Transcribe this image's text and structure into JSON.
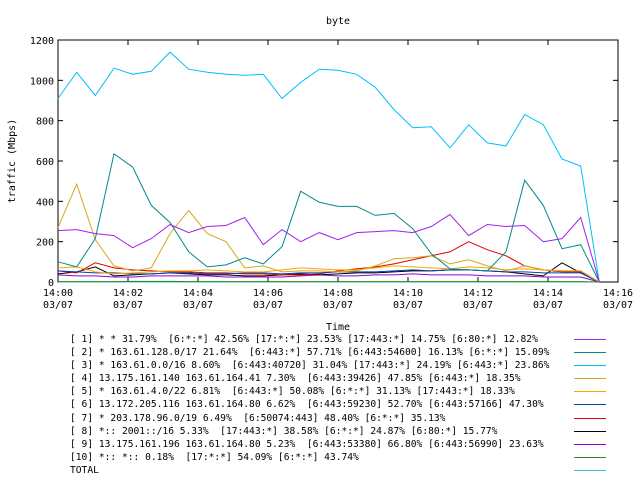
{
  "chart_data": {
    "type": "line",
    "title": "byte",
    "ylabel": "traffic (Mbps)",
    "xlabel": "Time",
    "ylim": [
      0,
      1200
    ],
    "xlim": [
      0,
      120
    ],
    "grid": false,
    "legend_placement": "below",
    "y_ticks": [
      "0",
      "200",
      "400",
      "600",
      "800",
      "1000",
      "1200"
    ],
    "x_ticks": [
      {
        "time": "14:00",
        "date": "03/07"
      },
      {
        "time": "14:02",
        "date": "03/07"
      },
      {
        "time": "14:04",
        "date": "03/07"
      },
      {
        "time": "14:06",
        "date": "03/07"
      },
      {
        "time": "14:08",
        "date": "03/07"
      },
      {
        "time": "14:10",
        "date": "03/07"
      },
      {
        "time": "14:12",
        "date": "03/07"
      },
      {
        "time": "14:14",
        "date": "03/07"
      },
      {
        "time": "14:16",
        "date": "03/07"
      }
    ],
    "x_minutes": [
      0,
      4,
      8,
      12,
      16,
      20,
      24,
      28,
      32,
      36,
      40,
      44,
      48,
      52,
      56,
      60,
      64,
      68,
      72,
      76,
      80,
      84,
      88,
      92,
      96,
      100,
      104,
      108,
      112
    ],
    "series": [
      {
        "name": "[ 1] * * 31.79%  [6:*:*] 42.56% [17:*:*] 23.53% [17:443:*] 14.75% [6:80:*] 12.82%",
        "color": "#a020f0",
        "values": [
          255,
          260,
          240,
          230,
          170,
          215,
          285,
          245,
          275,
          280,
          320,
          185,
          260,
          200,
          245,
          210,
          245,
          250,
          255,
          245,
          275,
          335,
          230,
          285,
          275,
          280,
          200,
          215,
          320
        ]
      },
      {
        "name": "[ 2] * 163.61.128.0/17 21.64%  [6:443:*] 57.71% [6:443:54600] 16.13% [6:*:*] 15.09%",
        "color": "#008b8b",
        "values": [
          100,
          75,
          215,
          635,
          570,
          380,
          295,
          150,
          75,
          85,
          120,
          90,
          175,
          450,
          395,
          375,
          375,
          330,
          340,
          265,
          140,
          65,
          60,
          55,
          150,
          505,
          380,
          165,
          185
        ]
      },
      {
        "name": "[ 3] * 163.61.0.0/16 8.60%  [6:443:40720] 31.04% [17:443:*] 24.19% [6:443:*] 23.86%",
        "color": "#00bfff",
        "values": [
          910,
          1040,
          925,
          1060,
          1030,
          1045,
          1140,
          1055,
          1040,
          1030,
          1025,
          1030,
          910,
          990,
          1055,
          1050,
          1030,
          965,
          855,
          765,
          770,
          665,
          780,
          690,
          675,
          830,
          780,
          610,
          575
        ]
      },
      {
        "name": "[ 4] 13.175.161.140 163.61.164.41 7.30%  [6:443:39426] 47.85% [6:443:*] 18.35%",
        "color": "#daa520",
        "values": [
          270,
          485,
          210,
          80,
          55,
          70,
          240,
          355,
          240,
          200,
          70,
          80,
          50,
          55,
          55,
          50,
          55,
          80,
          115,
          120,
          130,
          90,
          110,
          80,
          55,
          80,
          60,
          55,
          55
        ]
      },
      {
        "name": "[ 5] * 163.61.4.0/22 6.81%  [6:443:*] 50.08% [6:*:*] 31.13% [17:443:*] 18.33%",
        "color": "#ffa500",
        "values": [
          70,
          75,
          50,
          40,
          45,
          50,
          55,
          55,
          60,
          55,
          50,
          50,
          60,
          70,
          65,
          60,
          60,
          70,
          80,
          75,
          70,
          65,
          75,
          70,
          60,
          65,
          60,
          55,
          55
        ]
      },
      {
        "name": "[ 6] 13.172.205.116 163.61.164.80 6.62%  [6:443:59230] 52.70% [6:443:57166] 47.30%",
        "color": "#0047ab",
        "values": [
          55,
          50,
          45,
          45,
          40,
          40,
          45,
          45,
          40,
          40,
          45,
          45,
          40,
          45,
          45,
          50,
          50,
          50,
          55,
          60,
          55,
          60,
          60,
          55,
          50,
          50,
          45,
          45,
          45
        ]
      },
      {
        "name": "[ 7] * 203.178.96.0/19 6.49%  [6:50074:443] 48.40% [6:*:*] 35.13%",
        "color": "#e00000",
        "values": [
          55,
          45,
          95,
          70,
          60,
          55,
          50,
          50,
          45,
          45,
          40,
          40,
          35,
          35,
          40,
          55,
          65,
          75,
          90,
          110,
          130,
          150,
          200,
          160,
          130,
          80,
          60,
          50,
          50
        ]
      },
      {
        "name": "[ 8] *:: 2001::/16 5.33%  [17:443:*] 38.58% [6:*:*] 24.87% [6:80:*] 15.77%",
        "color": "#000000",
        "values": [
          40,
          50,
          75,
          30,
          35,
          40,
          45,
          40,
          35,
          35,
          30,
          30,
          35,
          40,
          35,
          40,
          45,
          45,
          50,
          55,
          55,
          60,
          60,
          55,
          50,
          40,
          30,
          95,
          45
        ]
      },
      {
        "name": "[ 9] 13.175.161.196 163.61.164.80 5.23%  [6:443:53380] 66.80% [6:443:56990] 23.63%",
        "color": "#9400d3",
        "values": [
          35,
          30,
          30,
          25,
          25,
          30,
          30,
          30,
          30,
          25,
          25,
          25,
          25,
          30,
          35,
          30,
          30,
          35,
          35,
          40,
          35,
          35,
          35,
          30,
          30,
          30,
          25,
          25,
          25
        ]
      },
      {
        "name": "[10] *:: *:: 0.18%  [17:*:*] 54.09% [6:*:*] 43.74%",
        "color": "#228b22",
        "values": [
          2,
          2,
          2,
          2,
          3,
          3,
          3,
          2,
          2,
          2,
          2,
          2,
          2,
          2,
          2,
          2,
          2,
          2,
          2,
          2,
          2,
          2,
          2,
          2,
          2,
          2,
          2,
          2,
          2
        ]
      },
      {
        "name": "TOTAL",
        "color": "#40c0c0",
        "values": [
          0,
          0,
          0,
          0,
          0,
          0,
          0,
          0,
          0,
          0,
          0,
          0,
          0,
          0,
          0,
          0,
          0,
          0,
          0,
          0,
          0,
          0,
          0,
          0,
          0,
          0,
          0,
          0,
          0
        ]
      }
    ]
  }
}
